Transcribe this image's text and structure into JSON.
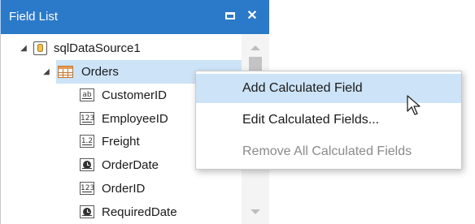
{
  "panel": {
    "title": "Field List",
    "maximize_icon": "maximize-icon",
    "close_symbol": "✕"
  },
  "tree": {
    "datasource": {
      "label": "sqlDataSource1",
      "icon": "database-icon",
      "expanded": true
    },
    "table": {
      "label": "Orders",
      "icon": "table-icon",
      "expanded": true,
      "selected": true
    },
    "fields": [
      {
        "label": "CustomerID",
        "type_badge": "ab",
        "icon": "string-field-icon"
      },
      {
        "label": "EmployeeID",
        "type_badge": "123",
        "icon": "number-field-icon"
      },
      {
        "label": "Freight",
        "type_badge": "1.2",
        "icon": "decimal-field-icon"
      },
      {
        "label": "OrderDate",
        "type_badge": "",
        "icon": "date-field-icon"
      },
      {
        "label": "OrderID",
        "type_badge": "123",
        "icon": "number-field-icon"
      },
      {
        "label": "RequiredDate",
        "type_badge": "",
        "icon": "date-field-icon"
      }
    ]
  },
  "context_menu": {
    "items": [
      {
        "label": "Add Calculated Field",
        "state": "highlighted"
      },
      {
        "label": "Edit Calculated Fields...",
        "state": "enabled"
      },
      {
        "label": "Remove All Calculated Fields",
        "state": "disabled"
      }
    ]
  },
  "colors": {
    "titlebar": "#2b79c9",
    "selection": "#cde3f7",
    "disabled_text": "#8a8a8a"
  }
}
